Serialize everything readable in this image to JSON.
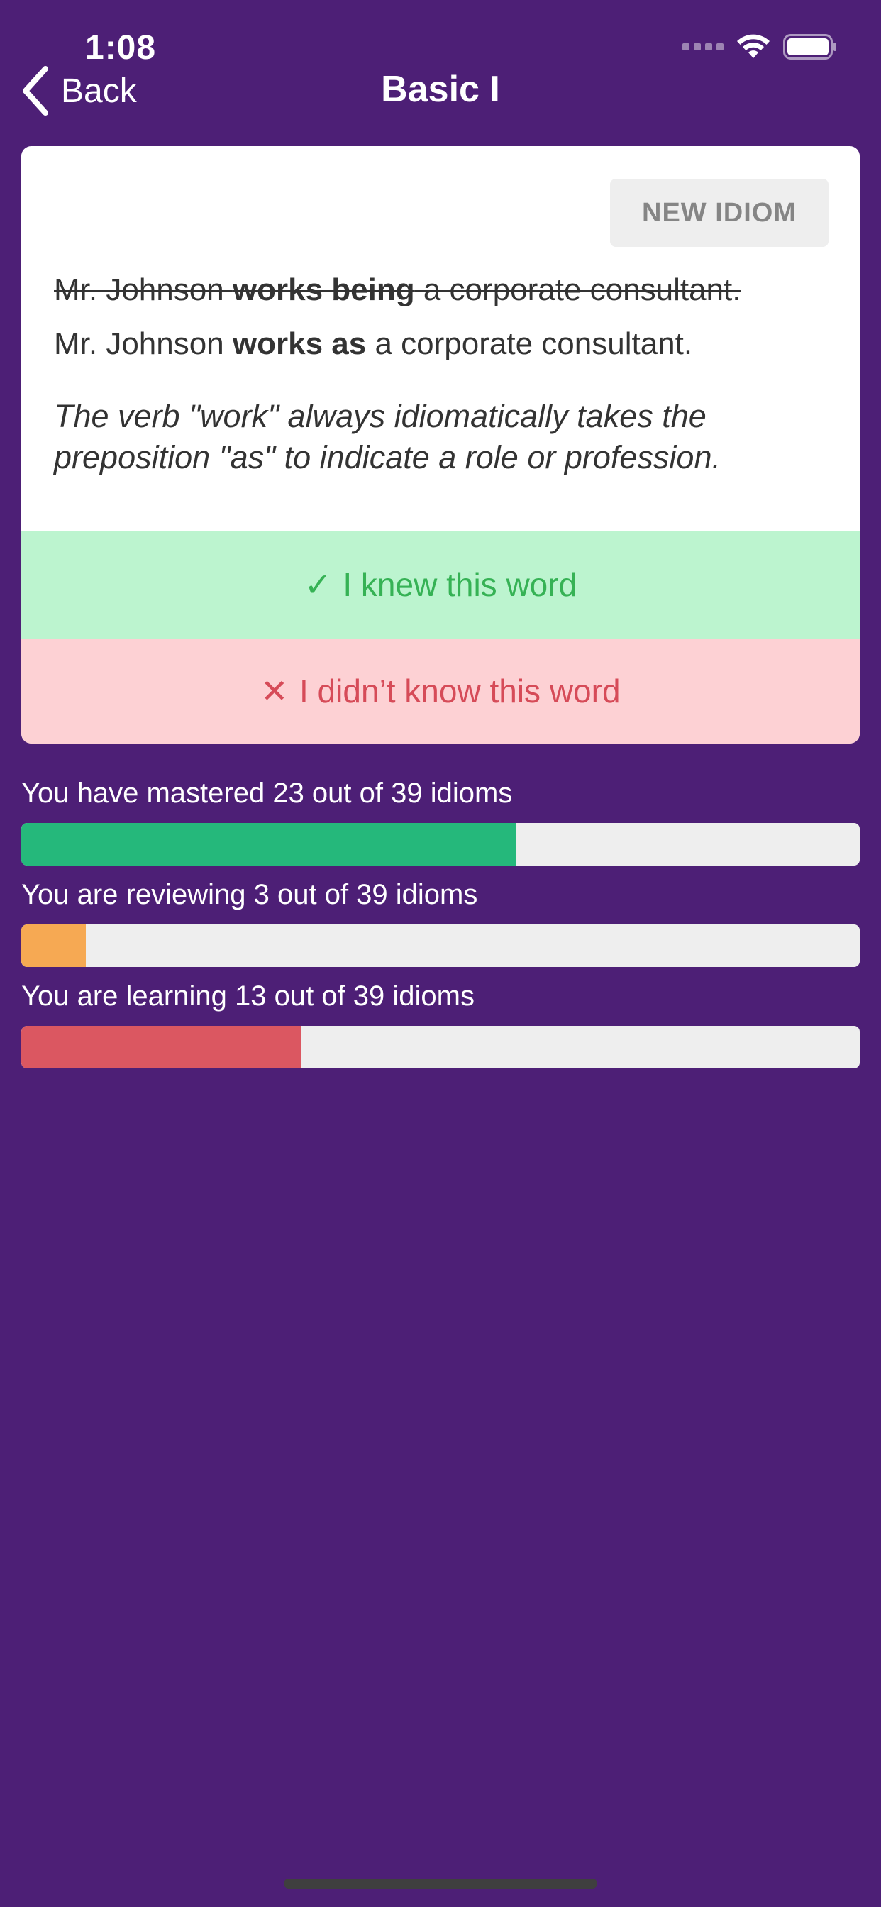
{
  "status_bar": {
    "time": "1:08",
    "signal_icon": "cellular-dots-icon",
    "wifi_icon": "wifi-icon",
    "battery_icon": "battery-icon"
  },
  "nav": {
    "back_label": "Back",
    "back_icon": "chevron-left-icon",
    "title": "Basic I"
  },
  "card": {
    "new_idiom_label": "NEW IDIOM",
    "wrong_sentence": {
      "before": "Mr. Johnson ",
      "emphasis": "works being",
      "after": " a corporate consultant."
    },
    "correct_sentence": {
      "before": "Mr. Johnson ",
      "emphasis": "works as",
      "after": " a corporate consultant."
    },
    "explanation": "The verb \"work\" always idiomatically takes the preposition \"as\" to indicate a role or profession.",
    "knew_button": {
      "mark": "✓",
      "label": "I knew this word"
    },
    "didnt_know_button": {
      "mark": "✕",
      "label": "I didn’t know this word"
    }
  },
  "progress": [
    {
      "label": "You have mastered 23 out of 39 idioms",
      "count": 23,
      "total": 39,
      "color": "#25b87b"
    },
    {
      "label": "You are reviewing 3 out of 39 idioms",
      "count": 3,
      "total": 39,
      "color": "#f6a953"
    },
    {
      "label": "You are learning 13 out of 39 idioms",
      "count": 13,
      "total": 39,
      "color": "#db5761"
    }
  ],
  "colors": {
    "background": "#4d1f76",
    "knew_bg": "#bcf4cf",
    "knew_text": "#36b255",
    "didnt_bg": "#fdd1d4",
    "didnt_text": "#d64b58"
  }
}
